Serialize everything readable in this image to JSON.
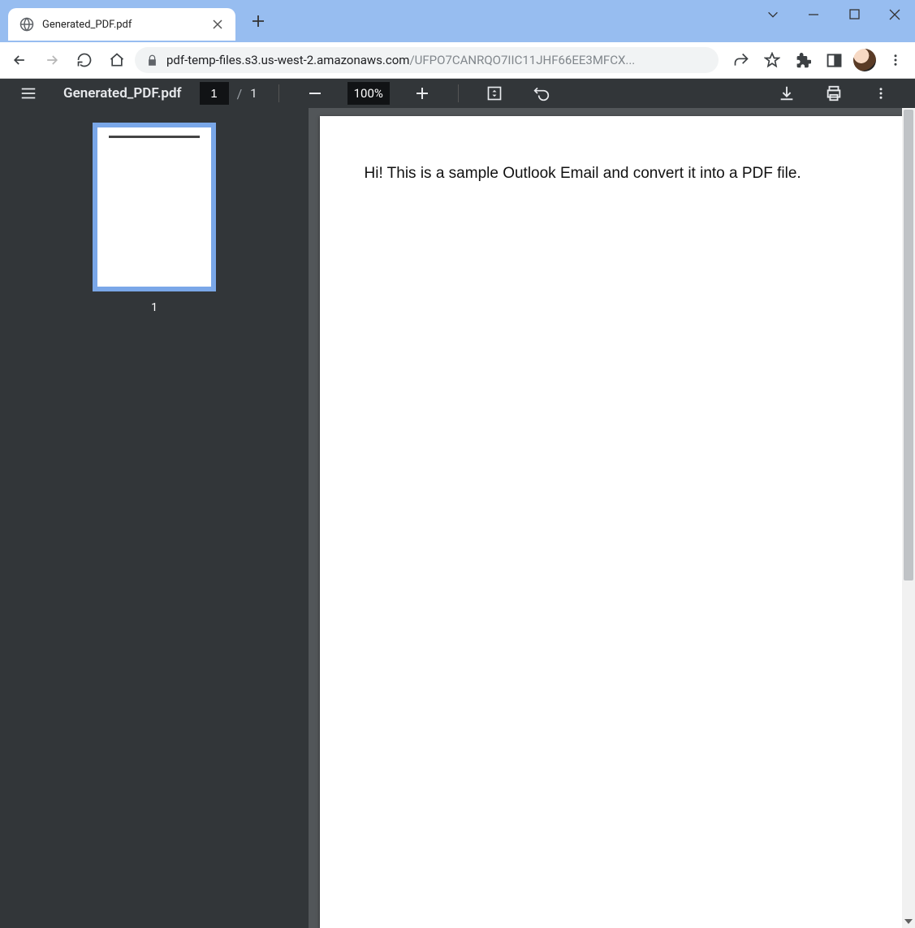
{
  "window": {
    "tab_title": "Generated_PDF.pdf"
  },
  "address": {
    "host": "pdf-temp-files.s3.us-west-2.amazonaws.com",
    "path": "/UFPO7CANRQO7IIC11JHF66EE3MFCX..."
  },
  "pdf_toolbar": {
    "file_name": "Generated_PDF.pdf",
    "page_current": "1",
    "page_separator": "/",
    "page_total": "1",
    "zoom_value": "100%"
  },
  "thumbnails": [
    {
      "number": "1"
    }
  ],
  "page_content": "Hi! This is a sample Outlook Email and convert it into a PDF file."
}
